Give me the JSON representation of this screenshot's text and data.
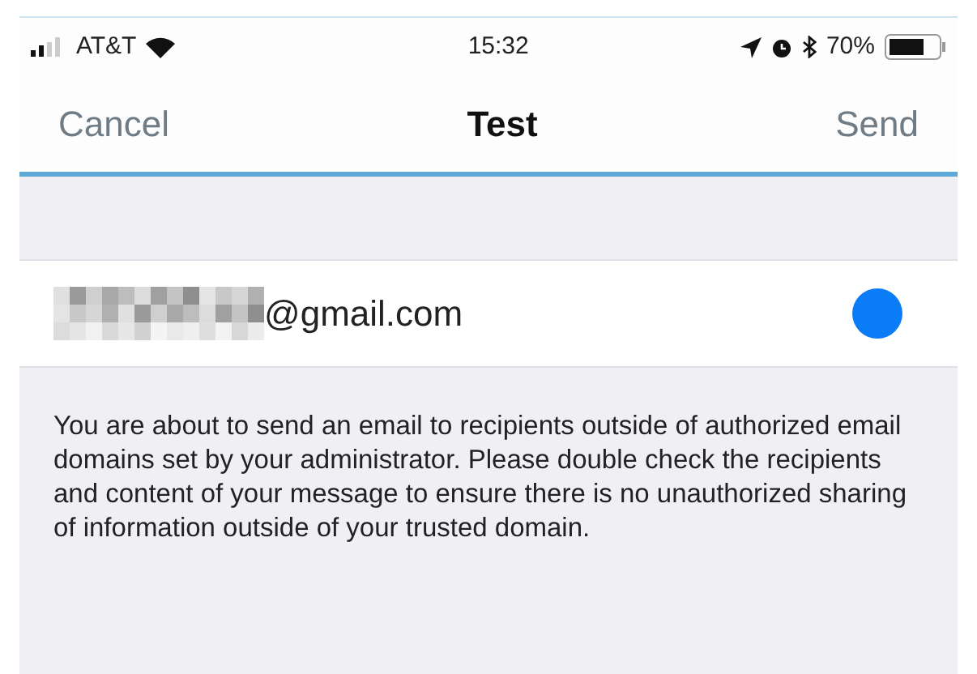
{
  "status_bar": {
    "carrier": "AT&T",
    "time": "15:32",
    "battery": "70%"
  },
  "nav": {
    "cancel": "Cancel",
    "title": "Test",
    "send": "Send"
  },
  "recipient": {
    "email": "@gmail.com"
  },
  "warning": "You are about to send an email to recipients outside of authorized email domains set by your administrator. Please double check the recipients and content of your message to ensure there is no unauthorized sharing of information outside of your trusted domain."
}
